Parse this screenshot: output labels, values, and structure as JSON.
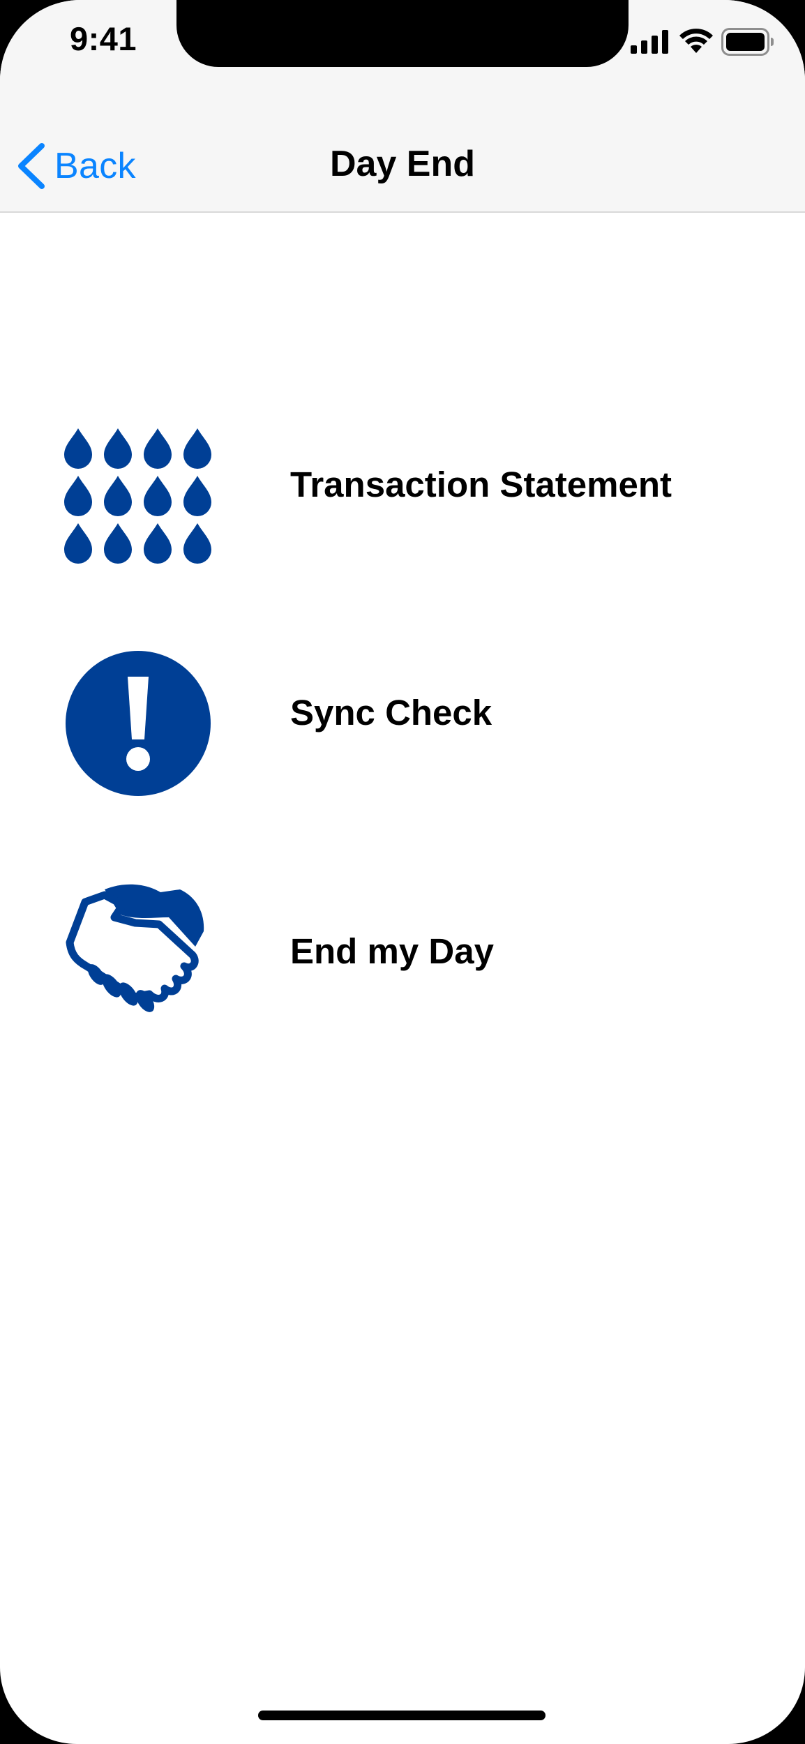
{
  "status_bar": {
    "time": "9:41",
    "icons": [
      "cellular-signal-icon",
      "wifi-icon",
      "battery-icon"
    ]
  },
  "nav_bar": {
    "back_label": "Back",
    "title": "Day End"
  },
  "menu": {
    "items": [
      {
        "label": "Transaction Statement",
        "icon": "drops-grid-icon"
      },
      {
        "label": "Sync Check",
        "icon": "exclamation-circle-icon"
      },
      {
        "label": "End my Day",
        "icon": "handshake-icon"
      }
    ]
  },
  "colors": {
    "accent": "#0a84ff",
    "icon_blue": "#003f95",
    "nav_background": "#f6f6f6",
    "text": "#000000"
  }
}
